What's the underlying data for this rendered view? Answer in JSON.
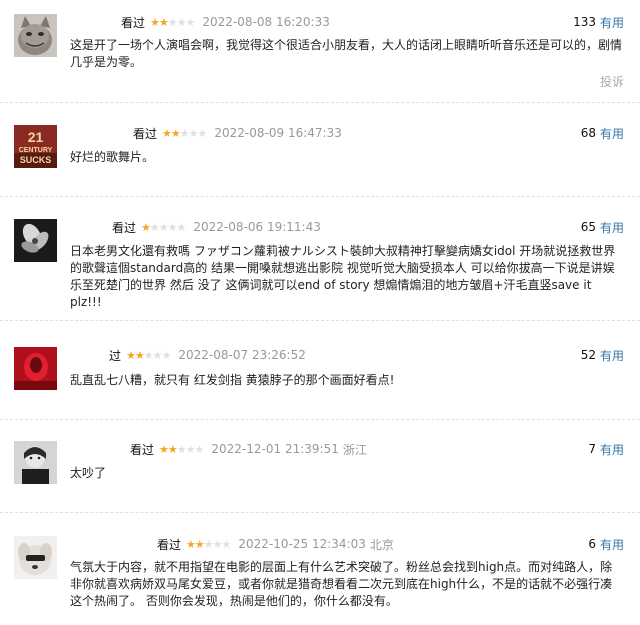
{
  "vote_label": "有用",
  "reviews": [
    {
      "status": "看过",
      "rating": 2,
      "time": "2022-08-08 16:20:33",
      "location": "",
      "votes": "133",
      "text": "这是开了一场个人演唱会啊，我觉得这个很适合小朋友看，大人的话闭上眼睛听听音乐还是可以的，剧情几乎是为零。",
      "report": "投诉",
      "avatar": "cat-avatar"
    },
    {
      "status": "看过",
      "rating": 2,
      "time": "2022-08-09 16:47:33",
      "location": "",
      "votes": "68",
      "text": "好烂的歌舞片。",
      "report": "",
      "avatar": "logo-avatar"
    },
    {
      "status": "看过",
      "rating": 1,
      "time": "2022-08-06 19:11:43",
      "location": "",
      "votes": "65",
      "text": "日本老男文化還有救嗎 ファザコン蘿莉被ナルシスト裝帥大叔精神打擊變病嬌女idol 开场就说拯救世界的歌聲這個standard高的 结果一開嗓就想逃出影院 视觉听觉大脑受损本人 可以给你拔高一下说是讲娱乐至死楚门的世界 然后 没了 这俩词就可以end of story 想煽情煽泪的地方皱眉+汗毛直竖save it plz!!!",
      "report": "",
      "avatar": "flower-avatar"
    },
    {
      "status": "过",
      "rating": 2,
      "time": "2022-08-07 23:26:52",
      "location": "",
      "votes": "52",
      "text": "乱直乱七八糟，就只有 红发剑指 黄猿脖子的那个画面好看点!",
      "report": "",
      "avatar": "red-avatar"
    },
    {
      "status": "看过",
      "rating": 2,
      "time": "2022-12-01 21:39:51",
      "location": "浙江",
      "votes": "7",
      "text": "太吵了",
      "report": "",
      "avatar": "portrait-avatar"
    },
    {
      "status": "看过",
      "rating": 2,
      "time": "2022-10-25 12:34:03",
      "location": "北京",
      "votes": "6",
      "text": "气氛大于内容，就不用指望在电影的层面上有什么艺术突破了。粉丝总会找到high点。而对纯路人，除非你就喜欢病娇双马尾女爱豆，或者你就是猎奇想看看二次元到底在high什么，不是的话就不必强行凑这个热闹了。 否则你会发现，热闹是他们的，你什么都没有。",
      "report": "",
      "avatar": "dog-avatar"
    }
  ]
}
